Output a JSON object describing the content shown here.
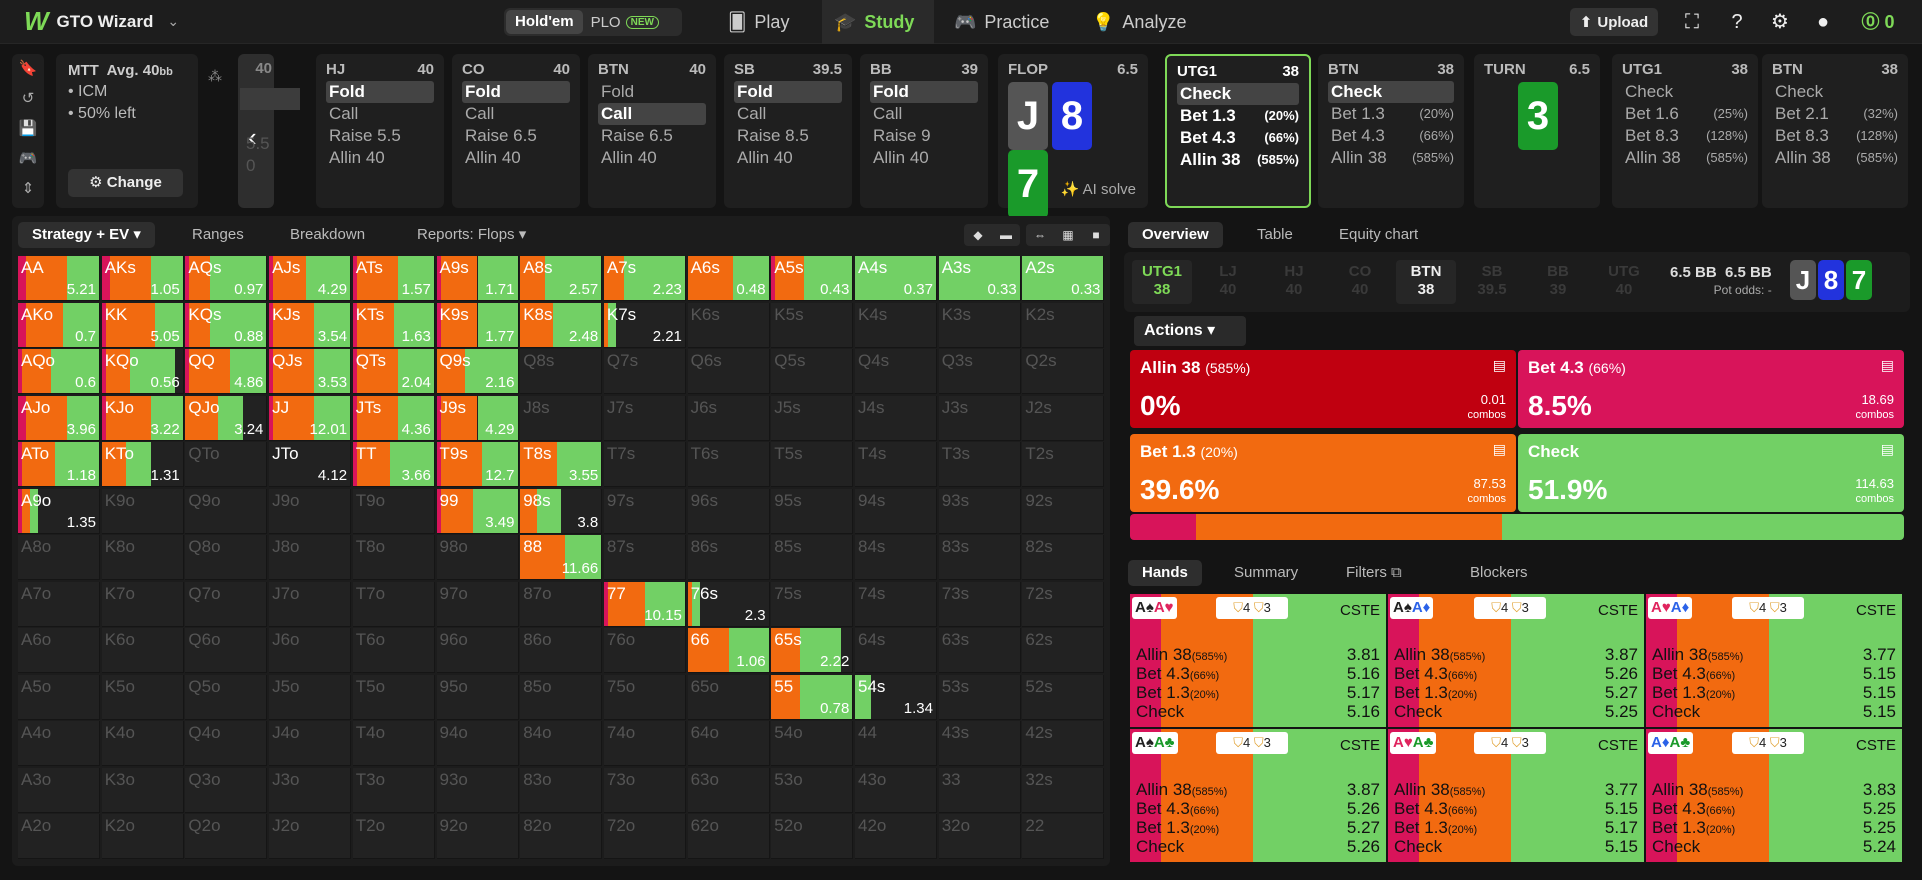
{
  "app": {
    "name": "GTO Wizard"
  },
  "game_toggle": {
    "holdem": "Hold'em",
    "plo": "PLO",
    "new_badge": "NEW"
  },
  "nav": {
    "play": "Play",
    "study": "Study",
    "practice": "Practice",
    "analyze": "Analyze",
    "upload": "Upload",
    "coins": "0"
  },
  "mtt": {
    "title": "MTT",
    "avg": "Avg. 40",
    "avg_unit": "bb",
    "icm": "ICM",
    "left": "50% left",
    "change": "Change"
  },
  "prev_stub": {
    "stack": "40",
    "line1": "5.5",
    "line2": "0"
  },
  "positions": [
    {
      "name": "HJ",
      "stack": "40",
      "opts": [
        {
          "t": "Fold",
          "sel": true
        },
        {
          "t": "Call"
        },
        {
          "t": "Raise 5.5"
        },
        {
          "t": "Allin 40"
        }
      ]
    },
    {
      "name": "CO",
      "stack": "40",
      "opts": [
        {
          "t": "Fold",
          "sel": true
        },
        {
          "t": "Call"
        },
        {
          "t": "Raise 6.5"
        },
        {
          "t": "Allin 40"
        }
      ]
    },
    {
      "name": "BTN",
      "stack": "40",
      "opts": [
        {
          "t": "Fold"
        },
        {
          "t": "Call",
          "sel": true
        },
        {
          "t": "Raise 6.5"
        },
        {
          "t": "Allin 40"
        }
      ]
    },
    {
      "name": "SB",
      "stack": "39.5",
      "opts": [
        {
          "t": "Fold",
          "sel": true
        },
        {
          "t": "Call"
        },
        {
          "t": "Raise 8.5"
        },
        {
          "t": "Allin 40"
        }
      ]
    },
    {
      "name": "BB",
      "stack": "39",
      "opts": [
        {
          "t": "Fold",
          "sel": true
        },
        {
          "t": "Call"
        },
        {
          "t": "Raise 9"
        },
        {
          "t": "Allin 40"
        }
      ]
    }
  ],
  "flop": {
    "label": "FLOP",
    "pot": "6.5",
    "cards": [
      "J",
      "8",
      "7"
    ],
    "ai_solve": "AI solve"
  },
  "utg1_flop": {
    "name": "UTG1",
    "stack": "38",
    "opts": [
      {
        "t": "Check",
        "p": "",
        "sel": true
      },
      {
        "t": "Bet 1.3",
        "p": "(20%)"
      },
      {
        "t": "Bet 4.3",
        "p": "(66%)"
      },
      {
        "t": "Allin 38",
        "p": "(585%)"
      }
    ]
  },
  "btn_flop": {
    "name": "BTN",
    "stack": "38",
    "opts": [
      {
        "t": "Check",
        "p": "",
        "sel": true
      },
      {
        "t": "Bet 1.3",
        "p": "(20%)"
      },
      {
        "t": "Bet 4.3",
        "p": "(66%)"
      },
      {
        "t": "Allin 38",
        "p": "(585%)"
      }
    ]
  },
  "turn": {
    "label": "TURN",
    "pot": "6.5",
    "card": "3"
  },
  "utg1_turn": {
    "name": "UTG1",
    "stack": "38",
    "opts": [
      {
        "t": "Check",
        "p": ""
      },
      {
        "t": "Bet 1.6",
        "p": "(25%)"
      },
      {
        "t": "Bet 8.3",
        "p": "(128%)"
      },
      {
        "t": "Allin 38",
        "p": "(585%)"
      }
    ]
  },
  "btn_turn": {
    "name": "BTN",
    "stack": "38",
    "opts": [
      {
        "t": "Check",
        "p": ""
      },
      {
        "t": "Bet 2.1",
        "p": "(32%)"
      },
      {
        "t": "Bet 8.3",
        "p": "(128%)"
      },
      {
        "t": "Allin 38",
        "p": "(585%)"
      }
    ]
  },
  "left_tabs": {
    "strategy": "Strategy + EV",
    "ranges": "Ranges",
    "breakdown": "Breakdown",
    "reports": "Reports: Flops"
  },
  "matrix": {
    "ranks": [
      "A",
      "K",
      "Q",
      "J",
      "T",
      "9",
      "8",
      "7",
      "6",
      "5",
      "4",
      "3",
      "2"
    ],
    "active": {
      "AA": [
        0.1,
        0.5,
        0.4,
        "5.21"
      ],
      "AKs": [
        0.1,
        0.5,
        0.4,
        "1.05"
      ],
      "AQs": [
        0.05,
        0.25,
        0.7,
        "0.97"
      ],
      "AJs": [
        0.05,
        0.4,
        0.55,
        "4.29"
      ],
      "ATs": [
        0.05,
        0.5,
        0.45,
        "1.57"
      ],
      "A9s": [
        0.05,
        0.45,
        0.5,
        "1.71"
      ],
      "A8s": [
        0,
        0.3,
        0.7,
        "2.57"
      ],
      "A7s": [
        0,
        0.25,
        0.75,
        "2.23"
      ],
      "A6s": [
        0,
        0.55,
        0.45,
        "0.48"
      ],
      "A5s": [
        0.05,
        0.35,
        0.6,
        "0.43"
      ],
      "A4s": [
        0,
        0,
        1,
        "0.37"
      ],
      "A3s": [
        0,
        0,
        1,
        "0.33"
      ],
      "A2s": [
        0,
        0,
        1,
        "0.33"
      ],
      "AKo": [
        0.1,
        0.45,
        0.45,
        "0.7"
      ],
      "KK": [
        0.05,
        0.6,
        0.35,
        "5.05"
      ],
      "KQs": [
        0.05,
        0.25,
        0.7,
        "0.88"
      ],
      "KJs": [
        0.05,
        0.5,
        0.45,
        "3.54"
      ],
      "KTs": [
        0.05,
        0.45,
        0.5,
        "1.63"
      ],
      "K9s": [
        0.05,
        0.45,
        0.5,
        "1.77"
      ],
      "K8s": [
        0,
        0.4,
        0.6,
        "2.48"
      ],
      "K7s": [
        0,
        0.05,
        0.1,
        "2.21"
      ],
      "AQo": [
        0.05,
        0.35,
        0.6,
        "0.6"
      ],
      "KQo": [
        0.05,
        0.3,
        0.55,
        "0.56"
      ],
      "QQ": [
        0.05,
        0.5,
        0.45,
        "4.86"
      ],
      "QJs": [
        0.05,
        0.5,
        0.45,
        "3.53"
      ],
      "QTs": [
        0.05,
        0.5,
        0.45,
        "2.04"
      ],
      "Q9s": [
        0,
        0.35,
        0.65,
        "2.16"
      ],
      "AJo": [
        0.1,
        0.5,
        0.4,
        "3.96"
      ],
      "KJo": [
        0.05,
        0.55,
        0.4,
        "3.22"
      ],
      "QJo": [
        0,
        0.4,
        0.3,
        "3.24"
      ],
      "JJ": [
        0.05,
        0.5,
        0.45,
        "12.01"
      ],
      "JTs": [
        0.05,
        0.5,
        0.45,
        "4.36"
      ],
      "J9s": [
        0.05,
        0.45,
        0.5,
        "4.29"
      ],
      "ATo": [
        0.05,
        0.4,
        0.55,
        "1.18"
      ],
      "KTo": [
        0,
        0.3,
        0.3,
        "1.31"
      ],
      "JTo": [
        0,
        0,
        0,
        "4.12"
      ],
      "TT": [
        0.05,
        0.4,
        0.55,
        "3.66"
      ],
      "T9s": [
        0.05,
        0.5,
        0.45,
        "12.7"
      ],
      "T8s": [
        0,
        0.45,
        0.55,
        "3.55"
      ],
      "A9o": [
        0.05,
        0.1,
        0.1,
        "1.35"
      ],
      "99": [
        0.05,
        0.4,
        0.55,
        "3.49"
      ],
      "98s": [
        0,
        0.2,
        0.3,
        "3.8"
      ],
      "88": [
        0,
        0.55,
        0.45,
        "11.66"
      ],
      "77": [
        0.05,
        0.45,
        0.5,
        "10.15"
      ],
      "76s": [
        0,
        0.05,
        0.1,
        "2.3"
      ],
      "66": [
        0,
        0.5,
        0.5,
        "1.06"
      ],
      "65s": [
        0,
        0.35,
        0.5,
        "2.22"
      ],
      "55": [
        0,
        0.35,
        0.65,
        "0.78"
      ],
      "54s": [
        0,
        0,
        0.2,
        "1.34"
      ]
    }
  },
  "right_tabs": {
    "overview": "Overview",
    "table": "Table",
    "equity": "Equity chart"
  },
  "pos_row": [
    {
      "n": "UTG1",
      "s": "38",
      "cls": "utg"
    },
    {
      "n": "LJ",
      "s": "40"
    },
    {
      "n": "HJ",
      "s": "40"
    },
    {
      "n": "CO",
      "s": "40"
    },
    {
      "n": "BTN",
      "s": "38",
      "cls": "hi"
    },
    {
      "n": "SB",
      "s": "39.5"
    },
    {
      "n": "BB",
      "s": "39"
    },
    {
      "n": "UTG",
      "s": "40"
    }
  ],
  "pot": {
    "a": "6.5 BB",
    "b": "6.5 BB",
    "odds_label": "Pot odds:",
    "odds_val": "-"
  },
  "actions": {
    "label": "Actions",
    "allin": {
      "name": "Allin 38",
      "pct": "(585%)",
      "freq": "0%",
      "combos": "0.01",
      "unit": "combos"
    },
    "bet43": {
      "name": "Bet 4.3",
      "pct": "(66%)",
      "freq": "8.5%",
      "combos": "18.69",
      "unit": "combos"
    },
    "bet13": {
      "name": "Bet 1.3",
      "pct": "(20%)",
      "freq": "39.6%",
      "combos": "87.53",
      "unit": "combos"
    },
    "check": {
      "name": "Check",
      "pct": "",
      "freq": "51.9%",
      "combos": "114.63",
      "unit": "combos"
    }
  },
  "hand_tabs": {
    "hands": "Hands",
    "summary": "Summary",
    "filters": "Filters",
    "blockers": "Blockers"
  },
  "hands": [
    {
      "c1": "A♠",
      "c2": "A♥",
      "e": [
        "3.81",
        "5.16",
        "5.17",
        "5.16"
      ]
    },
    {
      "c1": "A♠",
      "c2": "A♦",
      "e": [
        "3.87",
        "5.26",
        "5.27",
        "5.25"
      ]
    },
    {
      "c1": "A♥",
      "c2": "A♦",
      "e": [
        "3.77",
        "5.15",
        "5.15",
        "5.15"
      ]
    },
    {
      "c1": "A♠",
      "c2": "A♣",
      "e": [
        "3.87",
        "5.26",
        "5.27",
        "5.26"
      ]
    },
    {
      "c1": "A♥",
      "c2": "A♣",
      "e": [
        "3.77",
        "5.15",
        "5.17",
        "5.15"
      ]
    },
    {
      "c1": "A♦",
      "c2": "A♣",
      "e": [
        "3.83",
        "5.25",
        "5.25",
        "5.24"
      ]
    }
  ],
  "hand_labels": {
    "cste": "CSTE",
    "b1": "4",
    "b2": "3",
    "allin": "Allin 38",
    "allin_p": "(585%)",
    "bet43": "Bet 4.3",
    "bet43_p": "(66%)",
    "bet13": "Bet 1.3",
    "bet13_p": "(20%)",
    "check": "Check"
  },
  "colors": {
    "allin": "#c00010",
    "bet_big": "#d8145a",
    "bet_small": "#f26a10",
    "check": "#72d065",
    "brand": "#7ed957"
  }
}
